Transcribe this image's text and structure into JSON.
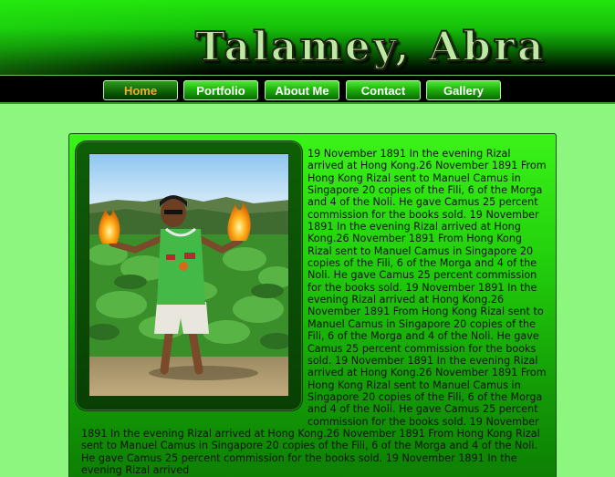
{
  "header": {
    "site_title": "Talamey, Abra"
  },
  "nav": {
    "items": [
      {
        "label": "Home",
        "active": true
      },
      {
        "label": "Portfolio",
        "active": false
      },
      {
        "label": "About Me",
        "active": false
      },
      {
        "label": "Contact",
        "active": false
      },
      {
        "label": "Gallery",
        "active": false
      }
    ]
  },
  "main": {
    "article_text": "19 November 1891 In the evening Rizal arrived at Hong Kong.26 November 1891 From Hong Kong Rizal sent to Manuel Camus in Singapore 20 copies of the Fili, 6 of the Morga and 4 of the Noli. He gave Camus 25 percent commission for the books sold. 19 November 1891 In the evening Rizal arrived at Hong Kong.26 November 1891 From Hong Kong Rizal sent to Manuel Camus in Singapore 20 copies of the Fili, 6 of the Morga and 4 of the Noli. He gave Camus 25 percent commission for the books sold. 19 November 1891 In the evening Rizal arrived at Hong Kong.26 November 1891 From Hong Kong Rizal sent to Manuel Camus in Singapore 20 copies of the Fili, 6 of the Morga and 4 of the Noli. He gave Camus 25 percent commission for the books sold. 19 November 1891 In the evening Rizal arrived at Hong Kong.26 November 1891 From Hong Kong Rizal sent to Manuel Camus in Singapore 20 copies of the Fili, 6 of the Morga and 4 of the Noli. He gave Camus 25 percent commission for the books sold. 19 November 1891 In the evening Rizal arrived at Hong Kong.26 November 1891 From Hong Kong Rizal sent to Manuel Camus in Singapore 20 copies of the Fili, 6 of the Morga and 4 of the Noli. He gave Camus 25 percent commission for the books sold. 19 November 1891 In the evening Rizal arrived"
  },
  "colors": {
    "page_background": "#8cf67f",
    "header_green": "#22e50d",
    "nav_active_text": "#f2a92d",
    "nav_text": "#ffffff"
  },
  "icons": {
    "photo": "person-with-fire-in-field-photo"
  }
}
